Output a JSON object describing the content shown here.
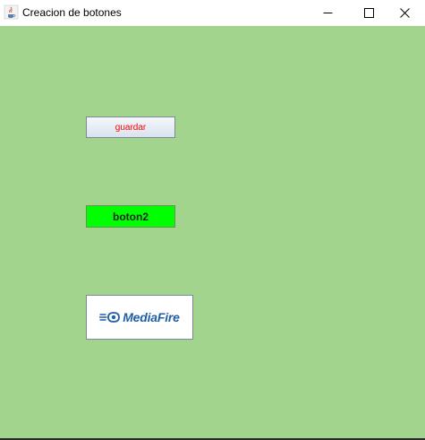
{
  "window": {
    "title": "Creacion de botones",
    "icon": "java-cup-icon",
    "background_color": "#a2d48d"
  },
  "titlebar_controls": {
    "minimize_icon": "minimize-icon",
    "maximize_icon": "maximize-icon",
    "close_icon": "close-icon"
  },
  "buttons": {
    "guardar": {
      "label": "guardar",
      "text_color": "#ff0000"
    },
    "boton2": {
      "label": "boton2",
      "background_color": "#00ff00"
    },
    "mediafire": {
      "icon": "mediafire-logo",
      "logo_text": "MediaFire"
    }
  }
}
